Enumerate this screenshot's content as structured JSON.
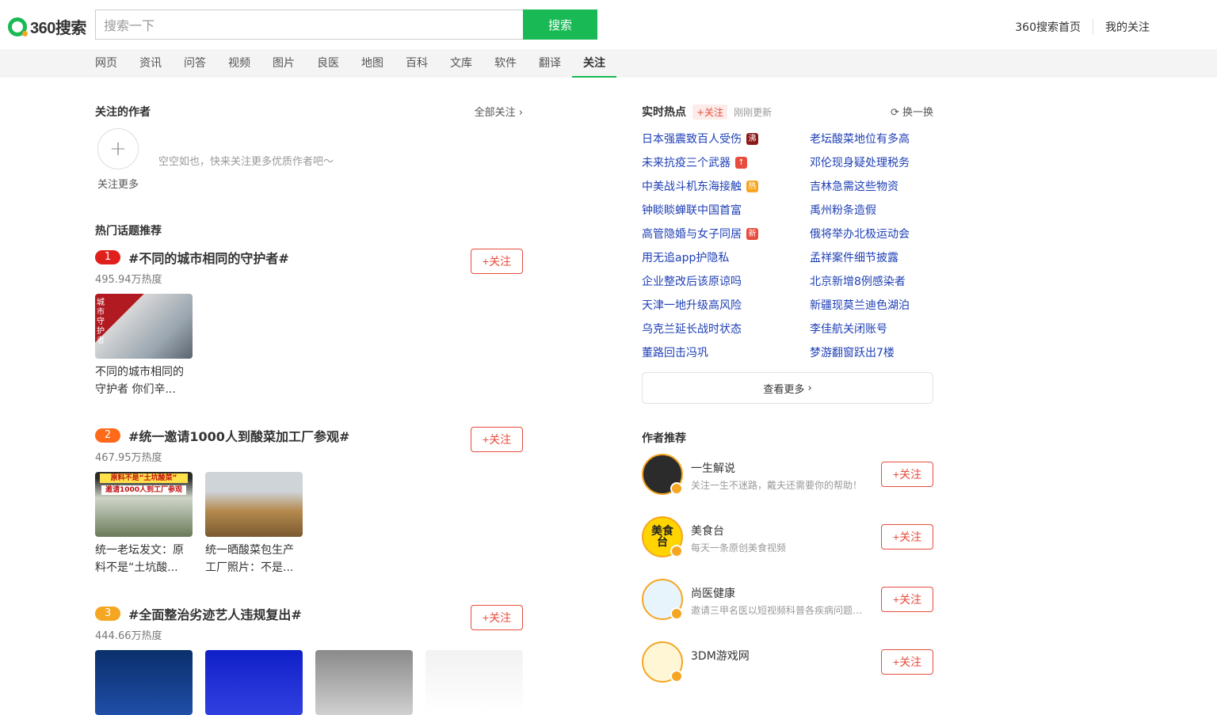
{
  "header": {
    "logo_text": "360搜索",
    "search_placeholder": "搜索一下",
    "search_button": "搜索",
    "links": [
      "360搜索首页",
      "我的关注"
    ]
  },
  "nav": {
    "items": [
      "网页",
      "资讯",
      "问答",
      "视频",
      "图片",
      "良医",
      "地图",
      "百科",
      "文库",
      "软件",
      "翻译",
      "关注"
    ],
    "active": "关注"
  },
  "followed_authors": {
    "title": "关注的作者",
    "all_link": "全部关注",
    "add_label": "关注更多",
    "empty_tip": "空空如也，快来关注更多优质作者吧～"
  },
  "hot_topics": {
    "title": "热门话题推荐",
    "follow_label": "+关注",
    "items": [
      {
        "rank": "1",
        "rank_color": "#e0201b",
        "name": "#不同的城市相同的守护者#",
        "heat": "495.94万热度",
        "thumbs": [
          {
            "caption": "不同的城市相同的守护者 你们辛...",
            "overlay": "城市守护者"
          }
        ]
      },
      {
        "rank": "2",
        "rank_color": "#ff6a1a",
        "name": "#统一邀请1000人到酸菜加工厂参观#",
        "heat": "467.95万热度",
        "thumbs": [
          {
            "caption": "统一老坛发文：原料不是“土坑酸...",
            "overlay": "原料不是“土坑酸菜”",
            "overlay2": "邀请1000人到工厂参观"
          },
          {
            "caption": "统一晒酸菜包生产工厂照片：不是...",
            "overlay": ""
          }
        ]
      },
      {
        "rank": "3",
        "rank_color": "#f5a623",
        "name": "#全面整治劣迹艺人违规复出#",
        "heat": "444.66万热度",
        "thumbs": [
          {
            "caption": ""
          },
          {
            "caption": ""
          },
          {
            "caption": ""
          },
          {
            "caption": ""
          }
        ]
      }
    ]
  },
  "realtime": {
    "title": "实时热点",
    "follow_tag": "+关注",
    "updated": "刚刚更新",
    "refresh": "换一换",
    "left": [
      {
        "text": "日本强震致百人受伤",
        "badge": "沸",
        "badge_color": "#8b1a1a"
      },
      {
        "text": "未来抗疫三个武器",
        "badge": "↑",
        "badge_color": "#e74c3c"
      },
      {
        "text": "中美战斗机东海接触",
        "badge": "热",
        "badge_color": "#f5a623"
      },
      {
        "text": "钟睒睒蝉联中国首富",
        "badge": ""
      },
      {
        "text": "高管隐婚与女子同居",
        "badge": "新",
        "badge_color": "#e74c3c"
      },
      {
        "text": "用无追app护隐私",
        "badge": ""
      },
      {
        "text": "企业整改后该原谅吗",
        "badge": ""
      },
      {
        "text": "天津一地升级高风险",
        "badge": ""
      },
      {
        "text": "乌克兰延长战时状态",
        "badge": ""
      },
      {
        "text": "董路回击冯巩",
        "badge": ""
      }
    ],
    "right": [
      {
        "text": "老坛酸菜地位有多高",
        "badge": "😂"
      },
      {
        "text": "邓伦现身疑处理税务",
        "badge": ""
      },
      {
        "text": "吉林急需这些物资",
        "badge": ""
      },
      {
        "text": "禹州粉条造假",
        "badge": ""
      },
      {
        "text": "俄将举办北极运动会",
        "badge": ""
      },
      {
        "text": "孟祥案件细节披露",
        "badge": ""
      },
      {
        "text": "北京新增8例感染者",
        "badge": ""
      },
      {
        "text": "新疆现莫兰迪色湖泊",
        "badge": ""
      },
      {
        "text": "李佳航关闭账号",
        "badge": ""
      },
      {
        "text": "梦游翻窗跃出7楼",
        "badge": ""
      }
    ],
    "more": "查看更多"
  },
  "authors": {
    "title": "作者推荐",
    "follow_label": "+关注",
    "items": [
      {
        "name": "一生解说",
        "desc": "关注一生不迷路，戴夫还需要你的帮助！",
        "avatar_bg": "#2b2b2b",
        "avatar_text": ""
      },
      {
        "name": "美食台",
        "desc": "每天一条原创美食视频",
        "avatar_bg": "#ffd400",
        "avatar_text": "美食台"
      },
      {
        "name": "尚医健康",
        "desc": "邀请三甲名医以短视频科普各疾病问题，传播健康知识",
        "avatar_bg": "#e8f4fb",
        "avatar_text": ""
      },
      {
        "name": "3DM游戏网",
        "desc": "",
        "avatar_bg": "#fff6d6",
        "avatar_text": ""
      }
    ]
  }
}
